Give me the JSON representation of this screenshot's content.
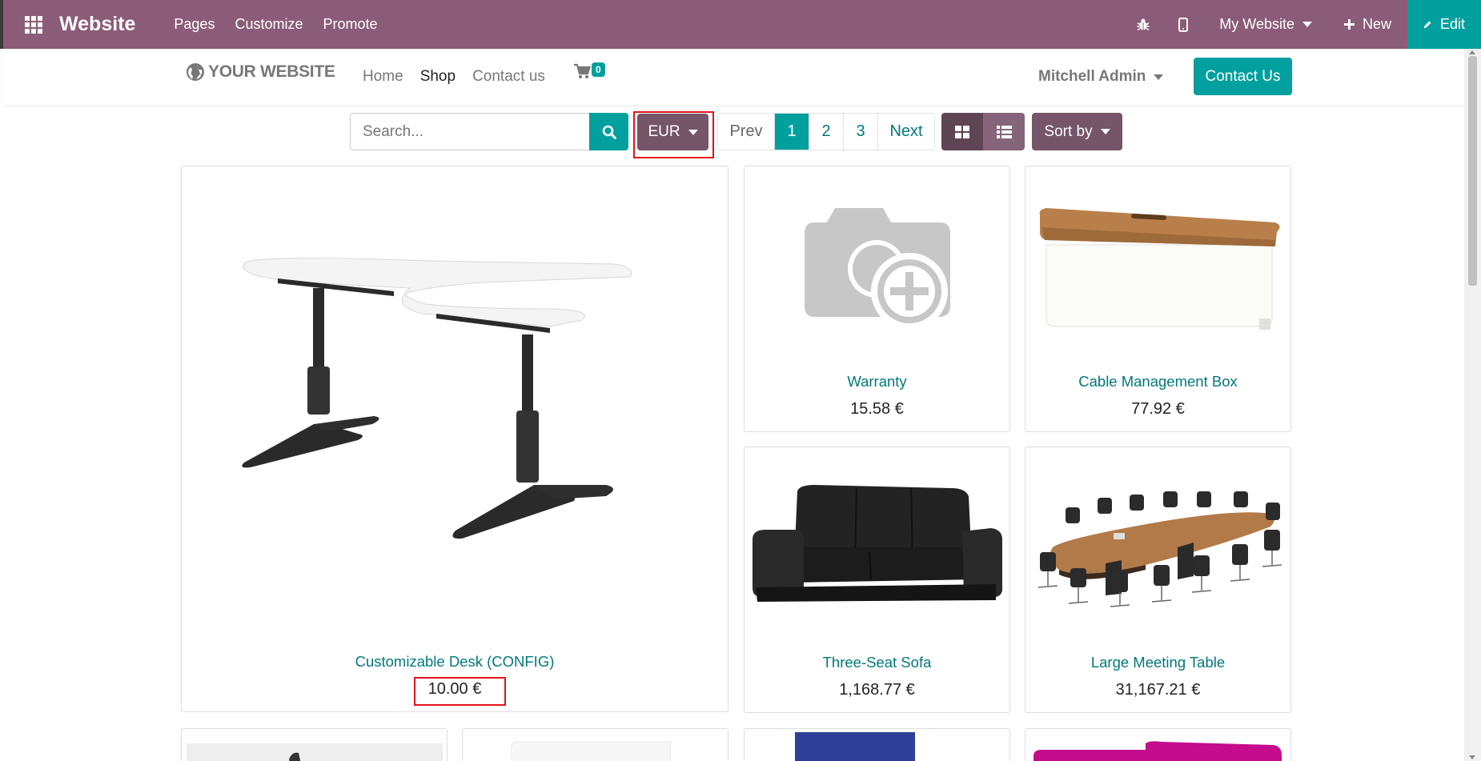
{
  "topbar": {
    "app_title": "Website",
    "menu": [
      "Pages",
      "Customize",
      "Promote"
    ],
    "site_selector": "My Website",
    "new_label": "New",
    "edit_label": "Edit"
  },
  "site_header": {
    "logo_text": "YOUR WEBSITE",
    "nav": [
      "Home",
      "Shop",
      "Contact us"
    ],
    "cart_count": "0",
    "user_name": "Mitchell Admin",
    "contact_button": "Contact Us"
  },
  "toolbar": {
    "search_placeholder": "Search...",
    "currency": "EUR",
    "pager": {
      "prev": "Prev",
      "pages": [
        "1",
        "2",
        "3"
      ],
      "next": "Next",
      "current": "1"
    },
    "sort_label": "Sort by"
  },
  "products": [
    {
      "name": "Customizable Desk (CONFIG)",
      "price": "10.00 €"
    },
    {
      "name": "Warranty",
      "price": "15.58 €"
    },
    {
      "name": "Cable Management Box",
      "price": "77.92 €"
    },
    {
      "name": "Three-Seat Sofa",
      "price": "1,168.77 €"
    },
    {
      "name": "Large Meeting Table",
      "price": "31,167.21 €"
    }
  ],
  "colors": {
    "topbar": "#8b5c77",
    "accent": "#01a09e",
    "secondary_button": "#755568",
    "highlight": "#e3121b"
  }
}
